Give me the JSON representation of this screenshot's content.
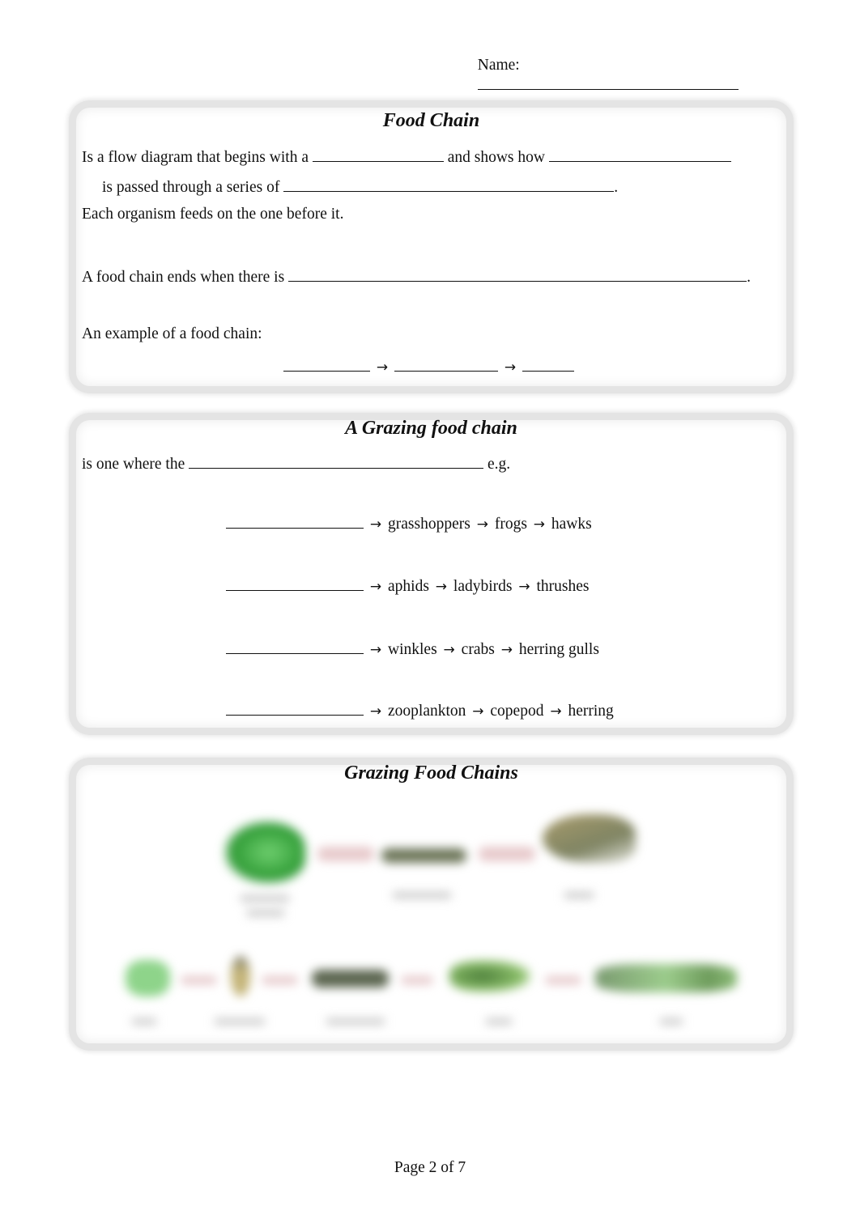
{
  "header": {
    "name_label": "Name:"
  },
  "food_chain": {
    "title": "Food Chain",
    "line1_a": "Is a flow diagram that begins with a",
    "line1_b": "and shows how",
    "line2_a": "is passed through a series of",
    "line2_end": ".",
    "line3": "Each organism feeds on the one before it.",
    "line4_a": "A food chain ends when there is",
    "line4_end": ".",
    "example_label": "An example of a food chain:",
    "arrow": "→"
  },
  "grazing_food_chain": {
    "title": "A Grazing food chain",
    "definition_a": "is one where the",
    "definition_end": "e.g.",
    "arrow": "→",
    "examples": [
      {
        "items": [
          "grasshoppers",
          "frogs",
          "hawks"
        ]
      },
      {
        "items": [
          "aphids",
          "ladybirds",
          "thrushes"
        ]
      },
      {
        "items": [
          "winkles",
          "crabs",
          "herring gulls"
        ]
      },
      {
        "items": [
          "zooplankton",
          "copepod",
          "herring"
        ]
      }
    ]
  },
  "grazing_food_chains_figure": {
    "title": "Grazing Food Chains",
    "note": "illustration is blurred; labels not legible"
  },
  "footer": {
    "page_label": "Page 2 of 7"
  }
}
